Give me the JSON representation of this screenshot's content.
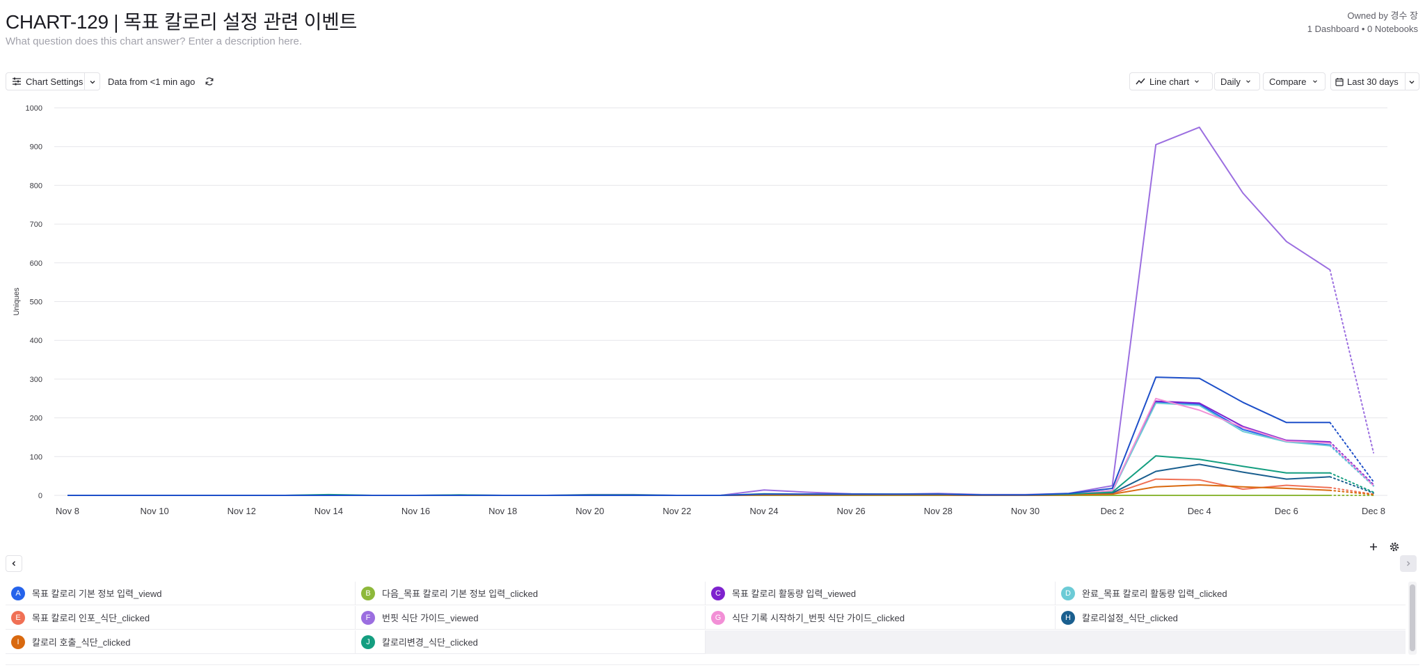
{
  "header": {
    "title": "CHART-129 | 목표 칼로리 설정 관련 이벤트",
    "description": "What question does this chart answer? Enter a description here.",
    "owner": "Owned by 경수 장",
    "meta": "1 Dashboard • 0 Notebooks"
  },
  "toolbar": {
    "chart_settings": "Chart Settings",
    "data_freshness": "Data from <1 min ago",
    "chart_type": "Line chart",
    "interval": "Daily",
    "compare": "Compare",
    "date_range": "Last 30 days"
  },
  "chart_data": {
    "type": "line",
    "ylabel": "Uniques",
    "ylim": [
      0,
      1000
    ],
    "yticks": [
      0,
      100,
      200,
      300,
      400,
      500,
      600,
      700,
      800,
      900,
      1000
    ],
    "x": [
      "Nov 8",
      "Nov 9",
      "Nov 10",
      "Nov 11",
      "Nov 12",
      "Nov 13",
      "Nov 14",
      "Nov 15",
      "Nov 16",
      "Nov 17",
      "Nov 18",
      "Nov 19",
      "Nov 20",
      "Nov 21",
      "Nov 22",
      "Nov 23",
      "Nov 24",
      "Nov 25",
      "Nov 26",
      "Nov 27",
      "Nov 28",
      "Nov 29",
      "Nov 30",
      "Dec 1",
      "Dec 2",
      "Dec 3",
      "Dec 4",
      "Dec 5",
      "Dec 6",
      "Dec 7",
      "Dec 8"
    ],
    "xticks": [
      "Nov 8",
      "Nov 10",
      "Nov 12",
      "Nov 14",
      "Nov 16",
      "Nov 18",
      "Nov 20",
      "Nov 22",
      "Nov 24",
      "Nov 26",
      "Nov 28",
      "Nov 30",
      "Dec 2",
      "Dec 4",
      "Dec 6",
      "Dec 8"
    ],
    "partial_last_point": true,
    "grid": true,
    "series": [
      {
        "id": "A",
        "name": "목표 칼로리 기본 정보 입력_viewd",
        "color": "#2563eb",
        "values": [
          0,
          0,
          0,
          0,
          0,
          0,
          0,
          0,
          0,
          0,
          0,
          0,
          0,
          0,
          0,
          0,
          2,
          2,
          2,
          2,
          2,
          1,
          1,
          4,
          12,
          240,
          235,
          170,
          140,
          130,
          25
        ]
      },
      {
        "id": "B",
        "name": "다음_목표 칼로리 기본 정보 입력_clicked",
        "color": "#8db83a",
        "values": [
          0,
          0,
          0,
          0,
          0,
          0,
          0,
          0,
          0,
          0,
          0,
          0,
          0,
          0,
          0,
          0,
          0,
          0,
          0,
          0,
          0,
          0,
          0,
          0,
          0,
          0,
          0,
          0,
          0,
          0,
          0
        ]
      },
      {
        "id": "C",
        "name": "목표 칼로리 활동량 입력_viewed",
        "color": "#7e22ce",
        "values": [
          0,
          0,
          0,
          0,
          0,
          0,
          0,
          0,
          0,
          0,
          0,
          0,
          0,
          0,
          0,
          0,
          2,
          2,
          2,
          2,
          2,
          1,
          1,
          4,
          10,
          243,
          238,
          178,
          142,
          138,
          28
        ]
      },
      {
        "id": "D",
        "name": "완료_목표 칼로리 활동량 입력_clicked",
        "color": "#6ccbd6",
        "values": [
          0,
          0,
          0,
          0,
          0,
          0,
          0,
          0,
          0,
          0,
          0,
          0,
          0,
          0,
          0,
          0,
          2,
          2,
          2,
          2,
          2,
          1,
          1,
          3,
          10,
          238,
          232,
          165,
          138,
          128,
          24
        ]
      },
      {
        "id": "E",
        "name": "목표 칼로리 인포_식단_clicked",
        "color": "#f07055",
        "values": [
          0,
          0,
          0,
          0,
          0,
          0,
          0,
          0,
          0,
          0,
          0,
          0,
          0,
          0,
          0,
          0,
          1,
          1,
          1,
          1,
          1,
          0,
          0,
          1,
          4,
          42,
          40,
          16,
          26,
          20,
          3
        ]
      },
      {
        "id": "F",
        "name": "번핏 식단 가이드_viewed",
        "color": "#9b6ee0",
        "values": [
          0,
          0,
          0,
          0,
          0,
          0,
          1,
          0,
          0,
          1,
          0,
          0,
          2,
          2,
          0,
          0,
          14,
          8,
          4,
          3,
          5,
          2,
          2,
          5,
          25,
          905,
          950,
          780,
          655,
          582,
          110
        ]
      },
      {
        "id": "G",
        "name": "식단 기록 시작하기_번핏 식단 가이드_clicked",
        "color": "#f28fd6",
        "values": [
          0,
          0,
          0,
          0,
          0,
          0,
          0,
          0,
          0,
          0,
          0,
          0,
          0,
          0,
          0,
          0,
          2,
          2,
          2,
          2,
          2,
          1,
          1,
          4,
          12,
          250,
          220,
          175,
          140,
          135,
          25
        ]
      },
      {
        "id": "H",
        "name": "칼로리설정_식단_clicked",
        "color": "#1a5f8f",
        "values": [
          0,
          0,
          0,
          0,
          0,
          0,
          0,
          0,
          0,
          0,
          0,
          0,
          0,
          0,
          0,
          0,
          1,
          1,
          1,
          1,
          1,
          0,
          0,
          1,
          6,
          62,
          80,
          60,
          42,
          48,
          6
        ]
      },
      {
        "id": "I",
        "name": "칼로리 호출_식단_clicked",
        "color": "#d9690f",
        "values": [
          0,
          0,
          0,
          0,
          0,
          0,
          0,
          0,
          0,
          0,
          0,
          0,
          0,
          0,
          0,
          0,
          1,
          1,
          1,
          1,
          1,
          0,
          0,
          1,
          3,
          22,
          27,
          22,
          18,
          13,
          2
        ]
      },
      {
        "id": "J",
        "name": "칼로리변경_식단_clicked",
        "color": "#149e80",
        "values": [
          0,
          0,
          0,
          0,
          0,
          0,
          2,
          0,
          0,
          1,
          0,
          0,
          1,
          1,
          0,
          0,
          4,
          3,
          3,
          3,
          3,
          1,
          1,
          3,
          8,
          102,
          93,
          75,
          58,
          58,
          8
        ]
      },
      {
        "id": "A2",
        "name": "",
        "color": "#1d4fc9",
        "values": [
          0,
          0,
          0,
          0,
          0,
          0,
          0,
          0,
          0,
          0,
          0,
          0,
          0,
          0,
          0,
          0,
          3,
          3,
          3,
          3,
          3,
          1,
          1,
          5,
          18,
          305,
          302,
          240,
          188,
          188,
          35
        ]
      }
    ]
  },
  "legend_order": [
    "A",
    "B",
    "C",
    "D",
    "E",
    "F",
    "G",
    "H",
    "I",
    "J"
  ]
}
